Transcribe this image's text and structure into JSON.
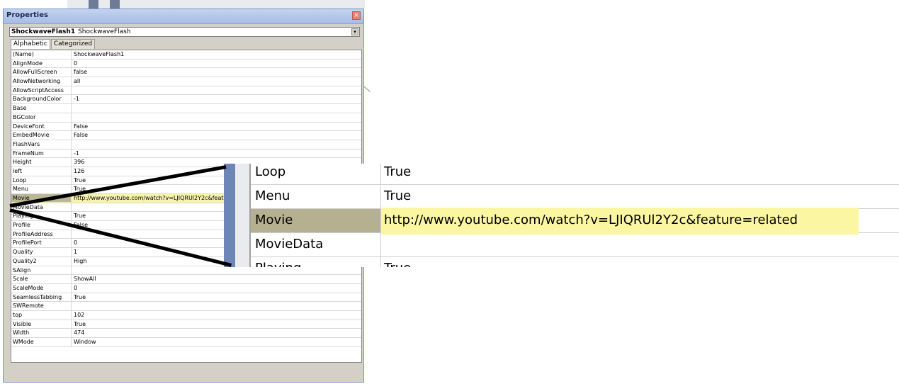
{
  "window": {
    "title": "Properties",
    "close_glyph": "×",
    "object_name": "ShockwaveFlash1",
    "object_type": "ShockwaveFlash",
    "dropdown_glyph": "▾",
    "tabs": [
      "Alphabetic",
      "Categorized"
    ]
  },
  "properties": [
    {
      "key": "(Name)",
      "value": "ShockwaveFlash1"
    },
    {
      "key": "AlignMode",
      "value": "0"
    },
    {
      "key": "AllowFullScreen",
      "value": "false"
    },
    {
      "key": "AllowNetworking",
      "value": "all"
    },
    {
      "key": "AllowScriptAccess",
      "value": ""
    },
    {
      "key": "BackgroundColor",
      "value": "-1"
    },
    {
      "key": "Base",
      "value": ""
    },
    {
      "key": "BGColor",
      "value": ""
    },
    {
      "key": "DeviceFont",
      "value": "False"
    },
    {
      "key": "EmbedMovie",
      "value": "False"
    },
    {
      "key": "FlashVars",
      "value": ""
    },
    {
      "key": "FrameNum",
      "value": "-1"
    },
    {
      "key": "Height",
      "value": "396"
    },
    {
      "key": "left",
      "value": "126"
    },
    {
      "key": "Loop",
      "value": "True"
    },
    {
      "key": "Menu",
      "value": "True"
    },
    {
      "key": "Movie",
      "value": "http://www.youtube.com/watch?v=LJIQRUl2Y2c&feature=related",
      "selected": true
    },
    {
      "key": "MovieData",
      "value": ""
    },
    {
      "key": "Playing",
      "value": "True"
    },
    {
      "key": "Profile",
      "value": "False"
    },
    {
      "key": "ProfileAddress",
      "value": ""
    },
    {
      "key": "ProfilePort",
      "value": "0"
    },
    {
      "key": "Quality",
      "value": "1"
    },
    {
      "key": "Quality2",
      "value": "High"
    },
    {
      "key": "SAlign",
      "value": ""
    },
    {
      "key": "Scale",
      "value": "ShowAll"
    },
    {
      "key": "ScaleMode",
      "value": "0"
    },
    {
      "key": "SeamlessTabbing",
      "value": "True"
    },
    {
      "key": "SWRemote",
      "value": ""
    },
    {
      "key": "top",
      "value": "102"
    },
    {
      "key": "Visible",
      "value": "True"
    },
    {
      "key": "Width",
      "value": "474"
    },
    {
      "key": "WMode",
      "value": "Window"
    }
  ],
  "zoom": {
    "rows": [
      {
        "key": "Loop",
        "value": "True"
      },
      {
        "key": "Menu",
        "value": "True"
      },
      {
        "key": "Movie",
        "value": "http://www.youtube.com/watch?v=LJIQRUl2Y2c&feature=related",
        "selected": true
      },
      {
        "key": "MovieData",
        "value": ""
      },
      {
        "key": "Playing",
        "value": "True"
      }
    ]
  },
  "colors": {
    "selected_key_bg": "#b5b190",
    "selected_value_bg": "#fbf6a2",
    "titlebar": "#a7bde6"
  }
}
